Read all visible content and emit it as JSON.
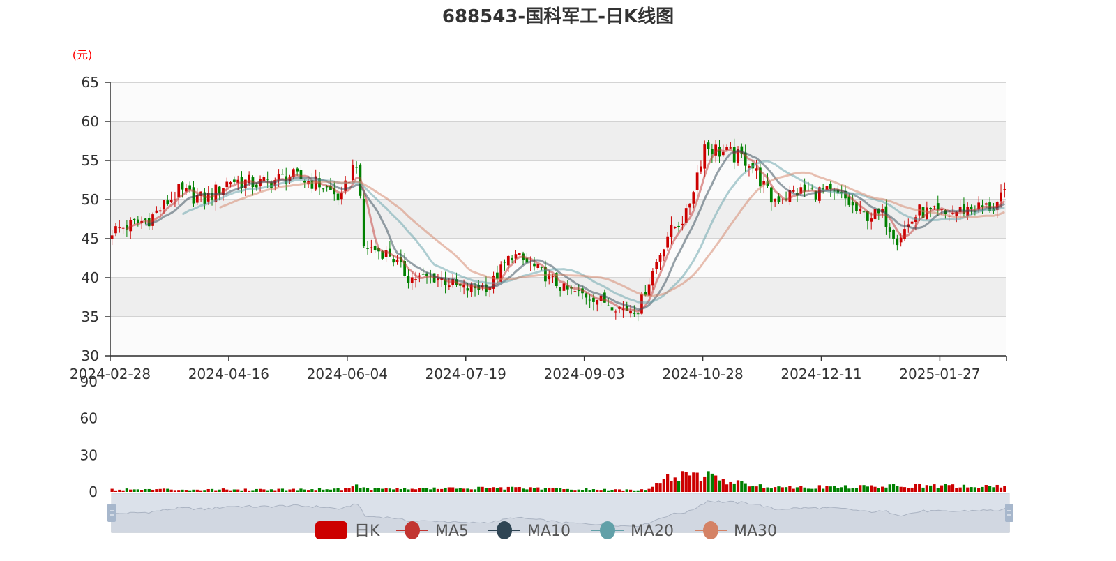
{
  "chart_data": {
    "type": "candlestick",
    "title": "688543-国科军工-日K线图",
    "ylabel": "(元)",
    "ylim": [
      30,
      65
    ],
    "yticks": [
      "30",
      "35",
      "40",
      "45",
      "50",
      "55",
      "60",
      "65"
    ],
    "volume_ylim": [
      0,
      90
    ],
    "volume_yticks": [
      "0",
      "30",
      "60",
      "90"
    ],
    "xtick_labels": [
      "2024-02-28",
      "2024-04-16",
      "2024-06-04",
      "2024-07-19",
      "2024-09-03",
      "2024-10-28",
      "2024-12-11",
      "2025-01-27"
    ],
    "trading_days": 242,
    "days_per_xtick": 32,
    "close_keypoints": [
      [
        0,
        46
      ],
      [
        10,
        47.5
      ],
      [
        18,
        51
      ],
      [
        25,
        50
      ],
      [
        32,
        52.5
      ],
      [
        40,
        52
      ],
      [
        48,
        53
      ],
      [
        56,
        52
      ],
      [
        62,
        50
      ],
      [
        64,
        53
      ],
      [
        66,
        55
      ],
      [
        68,
        44
      ],
      [
        75,
        43
      ],
      [
        80,
        40
      ],
      [
        88,
        40
      ],
      [
        95,
        38.5
      ],
      [
        102,
        39
      ],
      [
        108,
        43
      ],
      [
        115,
        41
      ],
      [
        122,
        38.5
      ],
      [
        130,
        37.5
      ],
      [
        138,
        36
      ],
      [
        142,
        36
      ],
      [
        147,
        42
      ],
      [
        150,
        45.5
      ],
      [
        155,
        48
      ],
      [
        160,
        57
      ],
      [
        165,
        56
      ],
      [
        172,
        55
      ],
      [
        178,
        50
      ],
      [
        185,
        51
      ],
      [
        192,
        51
      ],
      [
        198,
        50
      ],
      [
        202,
        48
      ],
      [
        208,
        48
      ],
      [
        212,
        45
      ],
      [
        218,
        48.5
      ],
      [
        225,
        48
      ],
      [
        232,
        49
      ],
      [
        238,
        49
      ],
      [
        241,
        50.5
      ]
    ],
    "volume_keypoints": [
      [
        0,
        2
      ],
      [
        40,
        2
      ],
      [
        62,
        2.5
      ],
      [
        66,
        5
      ],
      [
        70,
        2.5
      ],
      [
        100,
        3
      ],
      [
        110,
        3
      ],
      [
        140,
        1.5
      ],
      [
        146,
        3
      ],
      [
        148,
        10
      ],
      [
        152,
        13
      ],
      [
        156,
        12
      ],
      [
        160,
        15
      ],
      [
        164,
        9
      ],
      [
        172,
        6
      ],
      [
        180,
        4
      ],
      [
        200,
        4
      ],
      [
        218,
        5
      ],
      [
        241,
        4
      ]
    ],
    "series": [
      {
        "name": "日K",
        "type": "candlestick"
      },
      {
        "name": "MA5",
        "type": "line",
        "window": 5
      },
      {
        "name": "MA10",
        "type": "line",
        "window": 10
      },
      {
        "name": "MA20",
        "type": "line",
        "window": 20
      },
      {
        "name": "MA30",
        "type": "line",
        "window": 30
      }
    ],
    "colors": {
      "up": "#cc0000",
      "down": "#008000",
      "MA5": "#c23531",
      "MA10": "#2f4554",
      "MA20": "#61a0a8",
      "MA30": "#d48265",
      "title": "#333333",
      "unit": "#ff0000"
    },
    "legend_position": "bottom"
  }
}
